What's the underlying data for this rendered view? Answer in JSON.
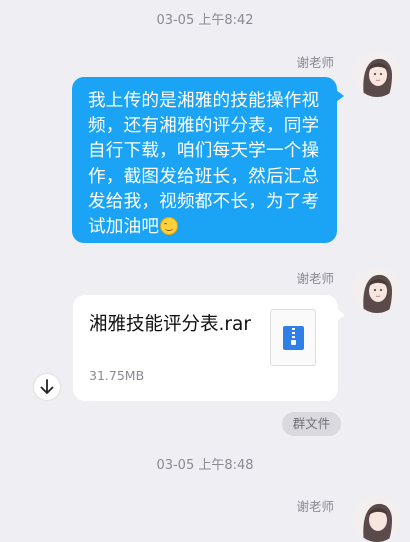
{
  "chat": {
    "timestamp_1": "03-05 上午8:42",
    "timestamp_2": "03-05 上午8:48",
    "messages": [
      {
        "sender": "谢老师",
        "text": "我上传的是湘雅的技能操作视频，还有湘雅的评分表，同学自行下载，咱们每天学一个操作，截图发给班长，然后汇总发给我，视频都不长，为了考试加油吧",
        "emoji": "smile-emoji-icon"
      },
      {
        "sender": "谢老师",
        "file": {
          "name": "湘雅技能评分表.rar",
          "size": "31.75MB",
          "icon": "zip-file-icon",
          "tag": "群文件"
        }
      },
      {
        "sender": "谢老师"
      }
    ]
  },
  "colors": {
    "background": "#eeeef3",
    "outgoing_bubble": "#1ba4f5",
    "file_card": "#ffffff",
    "zip_icon": "#2f7fe8"
  }
}
